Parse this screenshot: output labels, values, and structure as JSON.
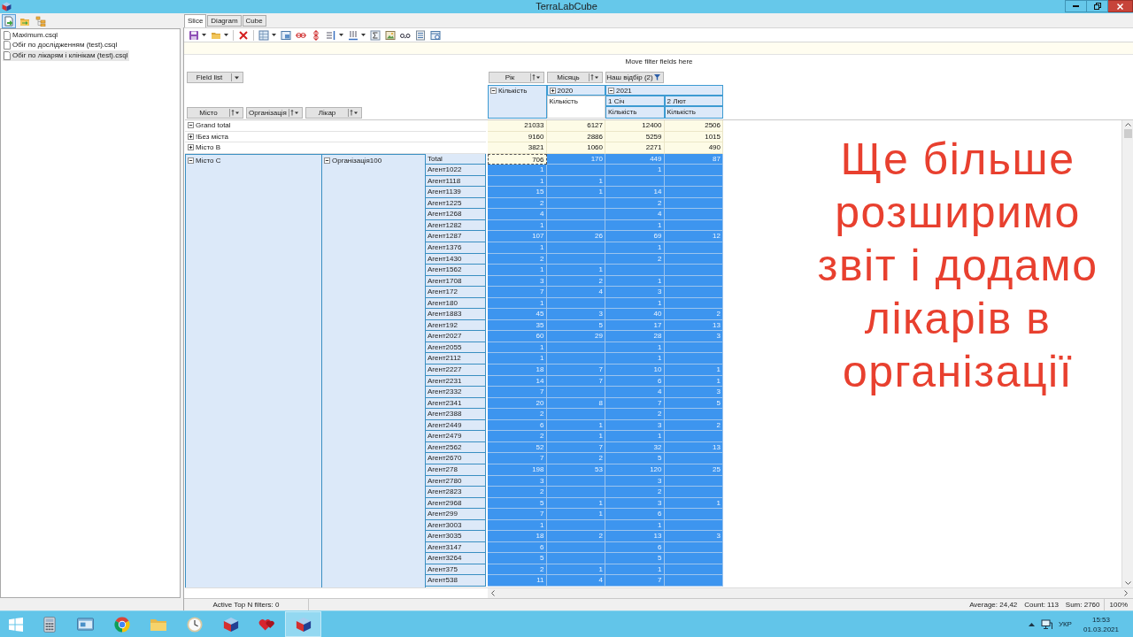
{
  "window": {
    "title": "TerraLabCube"
  },
  "sidebar": {
    "toolbar": [
      {
        "kind": "new",
        "selected": true
      },
      {
        "kind": "open",
        "selected": false
      },
      {
        "kind": "tree",
        "selected": false
      }
    ],
    "files": [
      {
        "name": "Maximum.csql",
        "selected": false
      },
      {
        "name": "Обіг по дослідженням (test).csql",
        "selected": false
      },
      {
        "name": "Обіг по лікарям і клінікам (test).csql",
        "selected": true
      }
    ]
  },
  "tabs": [
    {
      "label": "Slice",
      "selected": true
    },
    {
      "label": "Diagram",
      "selected": false
    },
    {
      "label": "Cube",
      "selected": false
    }
  ],
  "pivot": {
    "filter_hint": "Move filter fields here",
    "field_list": "Field list",
    "column_fields": [
      {
        "label": "Рік",
        "filtered": false
      },
      {
        "label": "Місяць",
        "filtered": false
      },
      {
        "label": "Наш відбір (2)",
        "filtered": true
      }
    ],
    "row_fields": [
      "Місто",
      "Організація",
      "Лікар"
    ],
    "column_header": {
      "measure": {
        "label": "Кількість",
        "expanded": true,
        "highlighted": true
      },
      "years": [
        {
          "label": "2020",
          "expanded": false,
          "measure": {
            "label": "Кількість",
            "highlighted": false
          }
        },
        {
          "label": "2021",
          "expanded": true,
          "months": [
            {
              "label": "1 Січ",
              "measure": {
                "label": "Кількість",
                "highlighted": true
              }
            },
            {
              "label": "2 Лют",
              "measure": {
                "label": "Кількість",
                "highlighted": true
              }
            }
          ]
        }
      ]
    },
    "summary_rows": [
      {
        "label": "Grand total",
        "expanded": true,
        "selected": false,
        "values": {
          "total": "21033",
          "year_2020": "6127",
          "jan_2021": "12400",
          "feb_2021": "2506"
        }
      },
      {
        "label": "!Без міста",
        "expanded": false,
        "selected": false,
        "values": {
          "total": "9160",
          "year_2020": "2886",
          "jan_2021": "5259",
          "feb_2021": "1015"
        }
      },
      {
        "label": "Місто B",
        "expanded": false,
        "selected": false,
        "values": {
          "total": "3821",
          "year_2020": "1060",
          "jan_2021": "2271",
          "feb_2021": "490"
        }
      }
    ],
    "group": {
      "city": {
        "label": "Місто C",
        "expanded": true
      },
      "organization": {
        "label": "Організація100",
        "expanded": true
      },
      "rows": [
        {
          "label": "Total",
          "selected": true,
          "focused": true,
          "values": {
            "total": "706",
            "year_2020": "170",
            "jan_2021": "449",
            "feb_2021": "87"
          }
        },
        {
          "label": "Агент1022",
          "selected": true,
          "values": {
            "total": "1",
            "jan_2021": "1"
          }
        },
        {
          "label": "Агент1118",
          "selected": true,
          "values": {
            "total": "1",
            "year_2020": "1"
          }
        },
        {
          "label": "Агент1139",
          "selected": true,
          "values": {
            "total": "15",
            "year_2020": "1",
            "jan_2021": "14"
          }
        },
        {
          "label": "Агент1225",
          "selected": true,
          "values": {
            "total": "2",
            "jan_2021": "2"
          }
        },
        {
          "label": "Агент1268",
          "selected": true,
          "values": {
            "total": "4",
            "jan_2021": "4"
          }
        },
        {
          "label": "Агент1282",
          "selected": true,
          "values": {
            "total": "1",
            "jan_2021": "1"
          }
        },
        {
          "label": "Агент1287",
          "selected": true,
          "values": {
            "total": "107",
            "year_2020": "26",
            "jan_2021": "69",
            "feb_2021": "12"
          }
        },
        {
          "label": "Агент1376",
          "selected": true,
          "values": {
            "total": "1",
            "jan_2021": "1"
          }
        },
        {
          "label": "Агент1430",
          "selected": true,
          "values": {
            "total": "2",
            "jan_2021": "2"
          }
        },
        {
          "label": "Агент1562",
          "selected": true,
          "values": {
            "total": "1",
            "year_2020": "1"
          }
        },
        {
          "label": "Агент1708",
          "selected": true,
          "values": {
            "total": "3",
            "year_2020": "2",
            "jan_2021": "1"
          }
        },
        {
          "label": "Агент172",
          "selected": true,
          "values": {
            "total": "7",
            "year_2020": "4",
            "jan_2021": "3"
          }
        },
        {
          "label": "Агент180",
          "selected": true,
          "values": {
            "total": "1",
            "jan_2021": "1"
          }
        },
        {
          "label": "Агент1883",
          "selected": true,
          "values": {
            "total": "45",
            "year_2020": "3",
            "jan_2021": "40",
            "feb_2021": "2"
          }
        },
        {
          "label": "Агент192",
          "selected": true,
          "values": {
            "total": "35",
            "year_2020": "5",
            "jan_2021": "17",
            "feb_2021": "13"
          }
        },
        {
          "label": "Агент2027",
          "selected": true,
          "values": {
            "total": "60",
            "year_2020": "29",
            "jan_2021": "28",
            "feb_2021": "3"
          }
        },
        {
          "label": "Агент2055",
          "selected": true,
          "values": {
            "total": "1",
            "jan_2021": "1"
          }
        },
        {
          "label": "Агент2112",
          "selected": true,
          "values": {
            "total": "1",
            "jan_2021": "1"
          }
        },
        {
          "label": "Агент2227",
          "selected": true,
          "values": {
            "total": "18",
            "year_2020": "7",
            "jan_2021": "10",
            "feb_2021": "1"
          }
        },
        {
          "label": "Агент2231",
          "selected": true,
          "values": {
            "total": "14",
            "year_2020": "7",
            "jan_2021": "6",
            "feb_2021": "1"
          }
        },
        {
          "label": "Агент2332",
          "selected": true,
          "values": {
            "total": "7",
            "jan_2021": "4",
            "feb_2021": "3"
          }
        },
        {
          "label": "Агент2341",
          "selected": true,
          "values": {
            "total": "20",
            "year_2020": "8",
            "jan_2021": "7",
            "feb_2021": "5"
          }
        },
        {
          "label": "Агент2388",
          "selected": true,
          "values": {
            "total": "2",
            "jan_2021": "2"
          }
        },
        {
          "label": "Агент2449",
          "selected": true,
          "values": {
            "total": "6",
            "year_2020": "1",
            "jan_2021": "3",
            "feb_2021": "2"
          }
        },
        {
          "label": "Агент2479",
          "selected": true,
          "values": {
            "total": "2",
            "year_2020": "1",
            "jan_2021": "1"
          }
        },
        {
          "label": "Агент2562",
          "selected": true,
          "values": {
            "total": "52",
            "year_2020": "7",
            "jan_2021": "32",
            "feb_2021": "13"
          }
        },
        {
          "label": "Агент2670",
          "selected": true,
          "values": {
            "total": "7",
            "year_2020": "2",
            "jan_2021": "5"
          }
        },
        {
          "label": "Агент278",
          "selected": true,
          "values": {
            "total": "198",
            "year_2020": "53",
            "jan_2021": "120",
            "feb_2021": "25"
          }
        },
        {
          "label": "Агент2780",
          "selected": true,
          "values": {
            "total": "3",
            "jan_2021": "3"
          }
        },
        {
          "label": "Агент2823",
          "selected": true,
          "values": {
            "total": "2",
            "jan_2021": "2"
          }
        },
        {
          "label": "Агент2968",
          "selected": true,
          "values": {
            "total": "5",
            "year_2020": "1",
            "jan_2021": "3",
            "feb_2021": "1"
          }
        },
        {
          "label": "Агент299",
          "selected": true,
          "values": {
            "total": "7",
            "year_2020": "1",
            "jan_2021": "6"
          }
        },
        {
          "label": "Агент3003",
          "selected": true,
          "values": {
            "total": "1",
            "jan_2021": "1"
          }
        },
        {
          "label": "Агент3035",
          "selected": true,
          "values": {
            "total": "18",
            "year_2020": "2",
            "jan_2021": "13",
            "feb_2021": "3"
          }
        },
        {
          "label": "Агент3147",
          "selected": true,
          "values": {
            "total": "6",
            "jan_2021": "6"
          }
        },
        {
          "label": "Агент3264",
          "selected": true,
          "values": {
            "total": "5",
            "jan_2021": "5"
          }
        },
        {
          "label": "Агент375",
          "selected": true,
          "values": {
            "total": "2",
            "year_2020": "1",
            "jan_2021": "1"
          }
        },
        {
          "label": "Агент538",
          "selected": true,
          "values": {
            "total": "11",
            "year_2020": "4",
            "jan_2021": "7"
          }
        }
      ]
    }
  },
  "annotation": "Ще більше розширимо звіт і додамо лікарів в організації",
  "status_bar": {
    "top_n": "Active Top N filters: 0",
    "stats": [
      "Average: 24,42",
      "Count: 113",
      "Sum: 2760"
    ],
    "zoom": "100%"
  },
  "taskbar": {
    "apps": [
      {
        "kind": "calculator",
        "selected": false
      },
      {
        "kind": "window",
        "selected": false
      },
      {
        "kind": "browser",
        "selected": false
      },
      {
        "kind": "folder",
        "selected": false
      },
      {
        "kind": "clock",
        "selected": false
      },
      {
        "kind": "cube",
        "selected": false
      },
      {
        "kind": "hearts",
        "selected": false
      },
      {
        "kind": "cube",
        "selected": true
      }
    ],
    "tray": {
      "language": "УКР",
      "time": "15:53",
      "date": "01.03.2021"
    }
  }
}
